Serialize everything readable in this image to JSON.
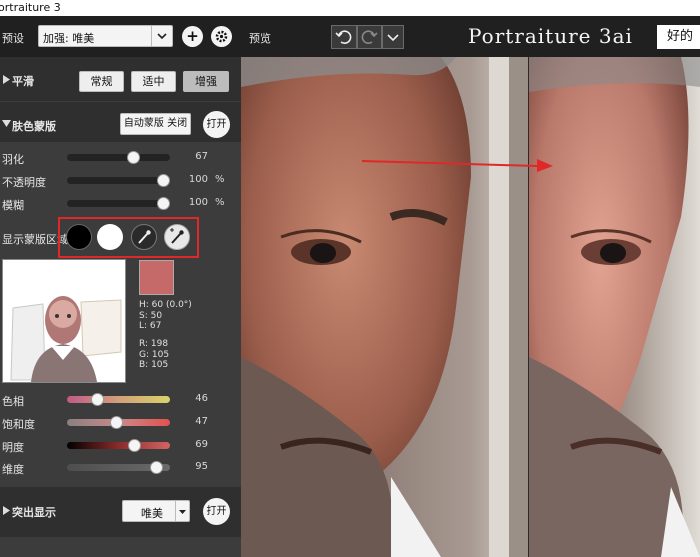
{
  "window_title": "ortraiture 3",
  "toolbar": {
    "preset_label": "预设",
    "preset_value": "加强: 唯美",
    "preview_label": "预览",
    "logo": "Portraiture 3ai",
    "good_button": "好的"
  },
  "smoothing": {
    "title": "平滑",
    "buttons": [
      "常规",
      "适中",
      "增强"
    ],
    "selected": "增强"
  },
  "skin_mask": {
    "title": "肤色蒙版",
    "auto_mask_button": "自动蒙版 关闭",
    "open_button": "打开",
    "sliders": [
      {
        "label": "羽化",
        "value": "67",
        "unit": "",
        "level": 0.67
      },
      {
        "label": "不透明度",
        "value": "100",
        "unit": "%",
        "level": 1.0
      },
      {
        "label": "模糊",
        "value": "100",
        "unit": "%",
        "level": 1.0
      }
    ],
    "show_mask_label": "显示蒙版区域",
    "swatch_color": "#c66969",
    "color_info": {
      "h": "H: 60 (0.0°)",
      "s": "S:  50",
      "l": "L:  67",
      "r": "R: 198",
      "g": "G: 105",
      "b": "B: 105"
    },
    "color_sliders": [
      {
        "label": "色相",
        "value": "46",
        "level": 0.27
      },
      {
        "label": "饱和度",
        "value": "47",
        "level": 0.48
      },
      {
        "label": "明度",
        "value": "69",
        "level": 0.68
      },
      {
        "label": "维度",
        "value": "95",
        "level": 0.92
      }
    ]
  },
  "highlight": {
    "title": "突出显示",
    "dropdown_value": "唯美",
    "open_button": "打开"
  },
  "colors": {
    "accent_red": "#e02828",
    "panel_bg": "#3c3c3c",
    "topbar_bg": "#202020"
  }
}
